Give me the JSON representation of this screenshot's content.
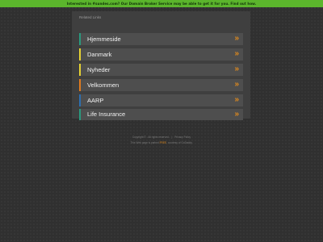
{
  "topbar": {
    "text": "Interested in #sundes.com? Our Domain Broker Service may be able to get it for you. Find out how."
  },
  "panel": {
    "title": "Related Links",
    "links": [
      {
        "label": "Hjemmeside",
        "arrow": "»",
        "accent": "#2a9a7e"
      },
      {
        "label": "Danmark",
        "arrow": "»",
        "accent": "#e6d233"
      },
      {
        "label": "Nyheder",
        "arrow": "»",
        "accent": "#e6d233"
      },
      {
        "label": "Velkommen",
        "arrow": "»",
        "accent": "#e07b1e"
      },
      {
        "label": "AARP",
        "arrow": "»",
        "accent": "#2e6fb0"
      },
      {
        "label": "Life Insurance",
        "arrow": "»",
        "accent": "#2a9a7e"
      }
    ]
  },
  "footer": {
    "copyright": "Copyright © . All rights reserved.",
    "separator": "|",
    "privacy": "Privacy Policy",
    "line2_prefix": "This Web page is parked",
    "line2_brand": "FREE",
    "line2_suffix": ", courtesy of GoDaddy."
  },
  "colors": {
    "topbar_bg": "#5bb52c",
    "page_bg": "#303030",
    "panel_bg": "#3f3f3f",
    "link_bg": "#4e4e4e",
    "arrow": "#e08a1e"
  }
}
